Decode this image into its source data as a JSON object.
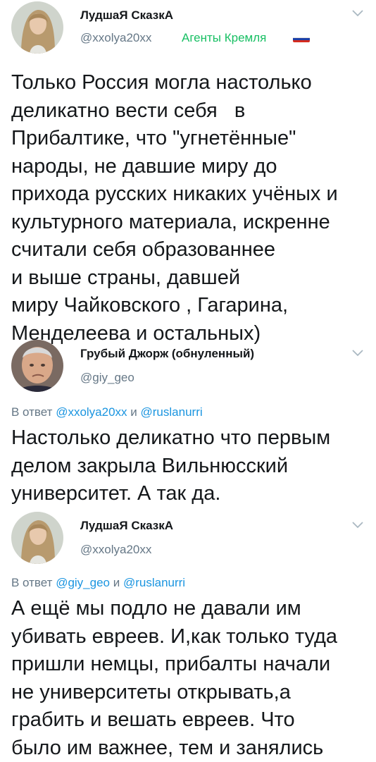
{
  "tweets": [
    {
      "author_name": "ЛудшаЯ СказкА",
      "handle": "@xxolya20xx",
      "badge": "Агенты Кремля",
      "lines": [
        "Только Россия могла настолько",
        "деликатно вести себя   в",
        "Прибалтике, что \"угнетённые\"",
        "народы, не давшие миру до",
        "прихода русских никаких учёных и",
        "культурного материала, искренне",
        "считали себя образованнее",
        "и выше страны, давшей",
        "миру Чайковского , Гагарина,",
        "Менделеева и остальных)"
      ]
    },
    {
      "author_name": "Грубый Джорж (обнуленный)",
      "handle": "@giy_geo",
      "reply_prefix": "В ответ",
      "reply_mention_1": "@xxolya20xx",
      "reply_and": "и",
      "reply_mention_2": "@ruslanurri",
      "lines": [
        "Настолько деликатно что первым",
        "делом закрыла Вильнюсский",
        "университет. А так да."
      ]
    },
    {
      "author_name": "ЛудшаЯ СказкА",
      "handle": "@xxolya20xx",
      "reply_prefix": "В ответ",
      "reply_mention_1": "@giy_geo",
      "reply_and": "и",
      "reply_mention_2": "@ruslanurri",
      "lines": [
        "А ещё мы подло не давали им",
        "убивать евреев. И,как только туда",
        "пришли немцы, прибалты начали",
        "не университеты открывать,а",
        "грабить и вешать евреев. Что",
        "было им важнее, тем и занялись"
      ]
    }
  ],
  "icons": {
    "avatar_1": "woman-portrait-avatar",
    "avatar_2": "man-portrait-avatar",
    "avatar_3": "woman-portrait-avatar",
    "flag": "russian-flag-icon",
    "menu": "chevron-down-icon"
  },
  "colors": {
    "text": "#14171a",
    "secondary": "#657786",
    "link": "#1b95e0",
    "badge": "#17bf63",
    "flag_white": "#ffffff",
    "flag_blue": "#1c3fa8",
    "flag_red": "#d52b1e"
  }
}
